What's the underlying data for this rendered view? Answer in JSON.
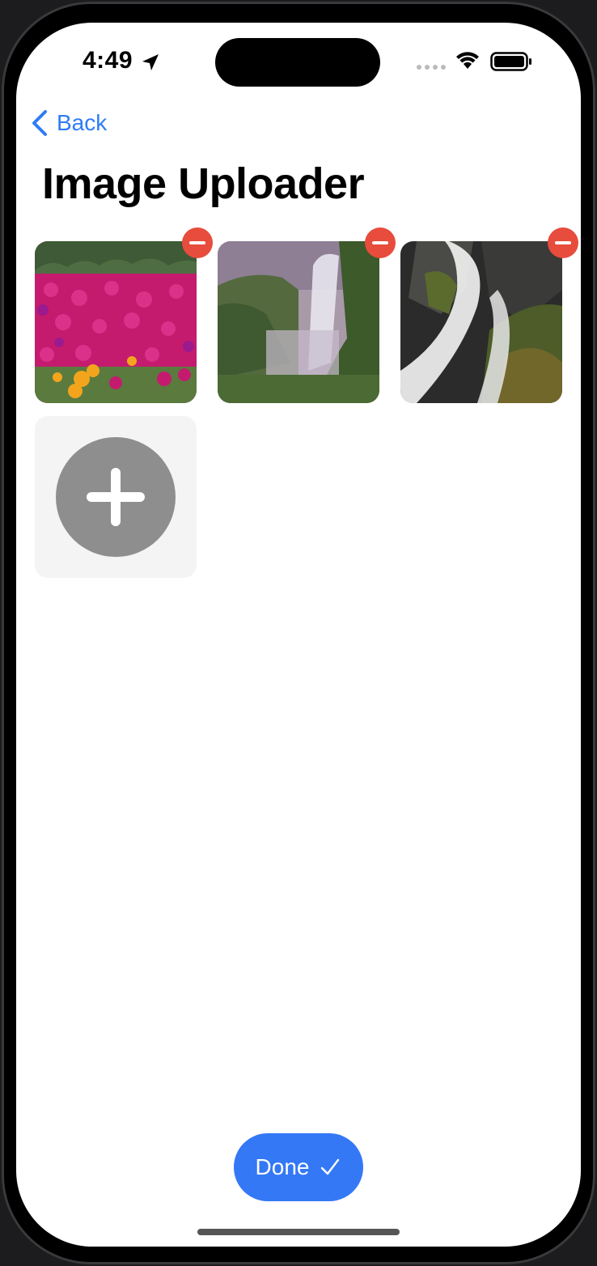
{
  "status_bar": {
    "time": "4:49",
    "icons": [
      "location-arrow-icon",
      "signal-icon",
      "wifi-icon",
      "battery-icon"
    ]
  },
  "nav": {
    "back_label": "Back",
    "back_icon": "chevron-left-icon"
  },
  "page": {
    "title": "Image Uploader"
  },
  "images": [
    {
      "name": "flowers-photo",
      "remove_icon": "minus-circle-icon"
    },
    {
      "name": "waterfall-valley-photo",
      "remove_icon": "minus-circle-icon"
    },
    {
      "name": "waterfall-rocks-photo",
      "remove_icon": "minus-circle-icon"
    }
  ],
  "add_tile": {
    "icon": "plus-circle-icon"
  },
  "done_button": {
    "label": "Done",
    "icon": "checkmark-icon"
  },
  "colors": {
    "accent": "#3478f6",
    "back_link": "#2f7cf6",
    "remove": "#e74c3c",
    "add_circle": "#8e8e8e",
    "add_tile_bg": "#f4f4f4"
  }
}
